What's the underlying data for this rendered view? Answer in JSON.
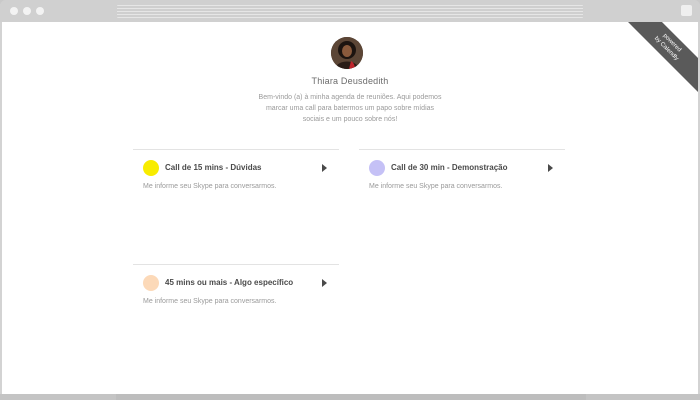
{
  "window": {
    "controls": [
      "close-dot",
      "minimize-dot",
      "zoom-dot"
    ]
  },
  "ribbon": {
    "line1": "powered",
    "line2": "by Calendly"
  },
  "profile": {
    "name": "Thiara Deusdedith",
    "welcome": "Bem-vindo (a) à minha agenda de reuniões. Aqui podemos marcar uma call para batermos um papo sobre mídias sociais e um pouco sobre nós!"
  },
  "events": [
    {
      "title": "Call de 15 mins - Dúvidas",
      "description": "Me informe seu Skype para conversarmos.",
      "color": "#f8ec00"
    },
    {
      "title": "Call de 30 min - Demonstração",
      "description": "Me informe seu Skype para conversarmos.",
      "color": "#c5c1f6"
    },
    {
      "title": "45 mins ou mais - Algo específico",
      "description": "Me informe seu Skype para conversarmos.",
      "color": "#fcd9b8"
    }
  ],
  "icons": {
    "arrow": "play-arrow-icon"
  }
}
